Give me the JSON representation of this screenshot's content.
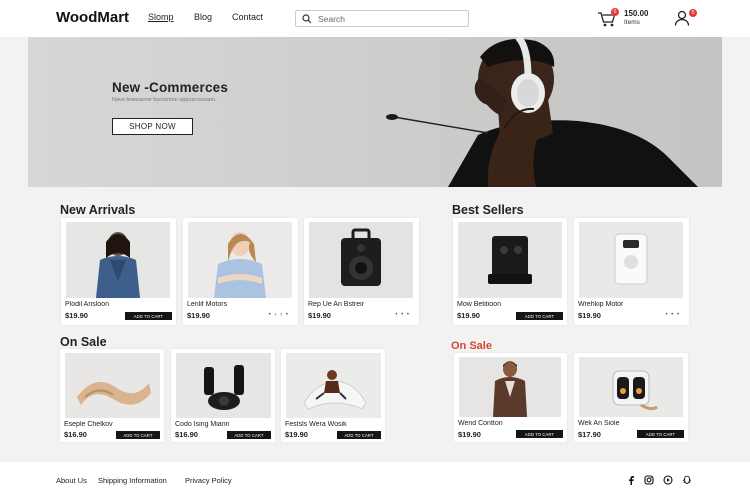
{
  "header": {
    "logo": "WoodMart",
    "nav": [
      "Slomp",
      "Blog",
      "Contact"
    ],
    "search_placeholder": "Search",
    "cart_badge": "0",
    "cart_total": "150.00",
    "cart_items": "Items",
    "account_badge": "0"
  },
  "hero": {
    "title": "New -Commerces",
    "subtitle": "Nave brweseme burosmon oppusconsaon.",
    "button": "SHOP NOW"
  },
  "new_arrivals": {
    "title": "New Arrivals",
    "products": [
      {
        "name": "Plodil Arisloon",
        "price": "$19.90",
        "button": "ADD TO CART",
        "image": "denim-jacket-woman"
      },
      {
        "name": "Lenlif Motors",
        "price": "$19.90",
        "dots": "• ‹ › •",
        "image": "woman-shirt"
      },
      {
        "name": "Rep Ue An Bstreir",
        "price": "$19.90",
        "dots": "• • •",
        "image": "speaker"
      }
    ]
  },
  "best_sellers": {
    "title": "Best Sellers",
    "products": [
      {
        "name": "Mow Betitioon",
        "price": "$19.90",
        "button": "ADD TO CART",
        "image": "black-device"
      },
      {
        "name": "Wrehkip Motor",
        "price": "$19.90",
        "dots": "• • •",
        "image": "white-device"
      }
    ]
  },
  "on_sale_left": {
    "title": "On Sale",
    "products": [
      {
        "name": "Eseple Chelkov",
        "price": "$16.90",
        "button": "ADD TO CART",
        "image": "sculpture"
      },
      {
        "name": "Codo Ising Miann",
        "price": "$16.90",
        "button": "ADD TO CART",
        "image": "earbuds"
      },
      {
        "name": "Festsls Wera Wosik",
        "price": "$19.90",
        "button": "ADD TO CART",
        "image": "chair-figure"
      }
    ]
  },
  "on_sale_right": {
    "title": "On Sale",
    "products": [
      {
        "name": "Wend Contton",
        "price": "$19.90",
        "button": "ADD TO CART",
        "image": "man-jacket"
      },
      {
        "name": "Wek An Siole",
        "price": "$17.90",
        "button": "ADD TO CART",
        "image": "gadget"
      }
    ]
  },
  "footer": {
    "links": [
      "About Us",
      "Shipping Information",
      "Privacy Policy"
    ],
    "social_icons": [
      "facebook-icon",
      "instagram-icon",
      "youtube-icon",
      "snapchat-icon"
    ]
  },
  "colors": {
    "accent_red": "#d9452f",
    "button_dark": "#151515"
  }
}
